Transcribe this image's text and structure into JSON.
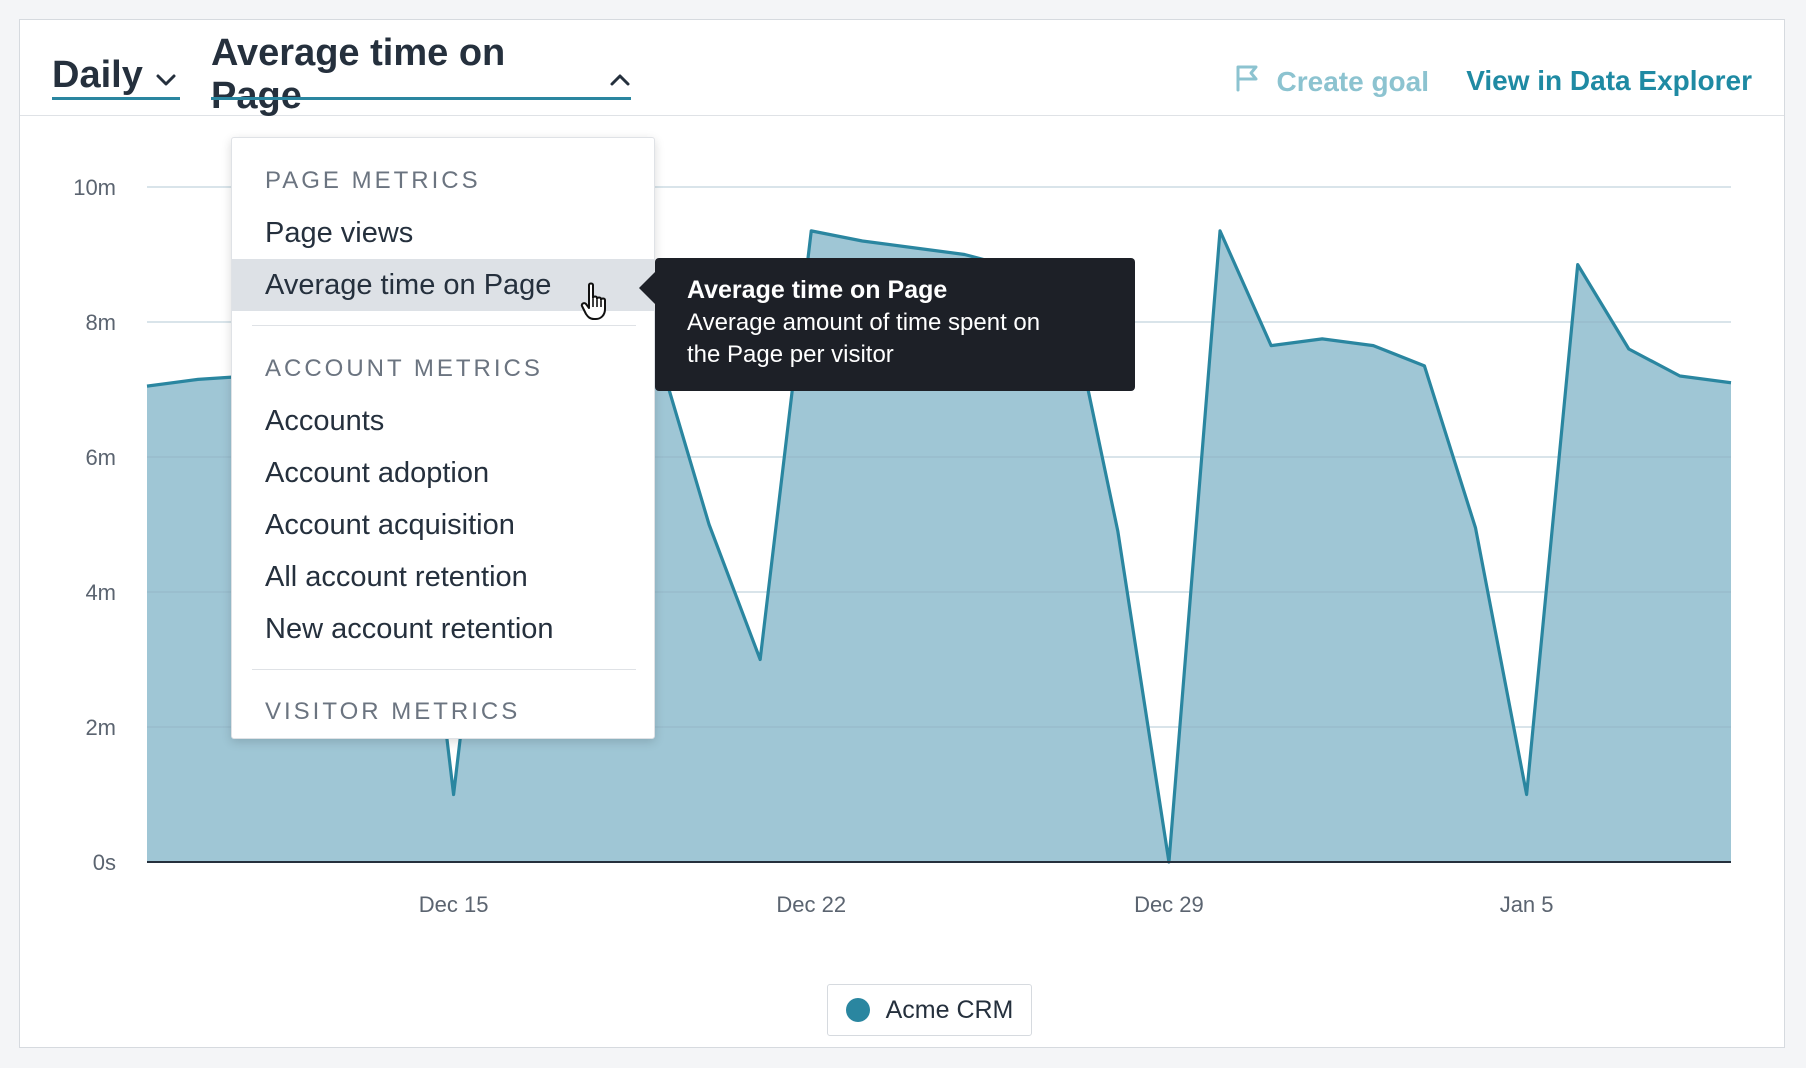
{
  "header": {
    "granularity": "Daily",
    "metric": "Average time on Page",
    "create_goal": "Create goal",
    "view_explorer": "View in Data Explorer"
  },
  "colors": {
    "accent": "#1f8aa3",
    "area_fill": "#9fc6d5",
    "line": "#2a86a0",
    "tooltip_bg": "#1d2027",
    "menu_active_bg": "#dde1e6",
    "create_goal_muted": "#8cc3d0"
  },
  "menu": {
    "groups": [
      {
        "title": "PAGE METRICS",
        "items": [
          {
            "label": "Page views",
            "active": false
          },
          {
            "label": "Average time on Page",
            "active": true
          }
        ]
      },
      {
        "title": "ACCOUNT METRICS",
        "items": [
          {
            "label": "Accounts",
            "active": false
          },
          {
            "label": "Account adoption",
            "active": false
          },
          {
            "label": "Account acquisition",
            "active": false
          },
          {
            "label": "All account retention",
            "active": false
          },
          {
            "label": "New account retention",
            "active": false
          }
        ]
      },
      {
        "title": "VISITOR METRICS",
        "items": []
      }
    ]
  },
  "tooltip": {
    "title": "Average time on Page",
    "description_line1": "Average amount of time spent on",
    "description_line2": "the Page per visitor"
  },
  "icons": {
    "daily_chevron": "chevron-down-icon",
    "metric_chevron": "chevron-up-icon",
    "create_goal": "flag-icon",
    "cursor": "hand-pointer-icon"
  },
  "chart_data": {
    "type": "area",
    "x": [
      "Dec 9",
      "Dec 10",
      "Dec 11",
      "Dec 12",
      "Dec 13",
      "Dec 14",
      "Dec 15",
      "Dec 16",
      "Dec 17",
      "Dec 18",
      "Dec 19",
      "Dec 20",
      "Dec 21",
      "Dec 22",
      "Dec 23",
      "Dec 24",
      "Dec 25",
      "Dec 26",
      "Dec 27",
      "Dec 28",
      "Dec 29",
      "Dec 30",
      "Dec 31",
      "Jan 1",
      "Jan 2",
      "Jan 3",
      "Jan 4",
      "Jan 5",
      "Jan 6",
      "Jan 7",
      "Jan 8",
      "Jan 9"
    ],
    "series": [
      {
        "name": "Acme CRM",
        "values": [
          7.05,
          7.15,
          7.2,
          7.25,
          7.3,
          7.35,
          1.0,
          7.4,
          7.45,
          7.5,
          7.55,
          5.0,
          3.0,
          9.35,
          9.2,
          9.1,
          9.0,
          8.8,
          8.5,
          4.9,
          0.0,
          9.35,
          7.65,
          7.75,
          7.65,
          7.35,
          4.95,
          1.0,
          8.85,
          7.6,
          7.2,
          7.1
        ]
      }
    ],
    "y_unit": "minutes",
    "ylim": [
      0,
      10
    ],
    "y_ticks": [
      0,
      2,
      4,
      6,
      8,
      10
    ],
    "y_tick_labels": [
      "0s",
      "2m",
      "4m",
      "6m",
      "8m",
      "10m"
    ],
    "x_ticks": [
      {
        "label": "Dec 15",
        "index": 6
      },
      {
        "label": "Dec 22",
        "index": 13
      },
      {
        "label": "Dec 29",
        "index": 20
      },
      {
        "label": "Jan 5",
        "index": 27
      }
    ],
    "grid": true,
    "legend": "bottom-center"
  }
}
